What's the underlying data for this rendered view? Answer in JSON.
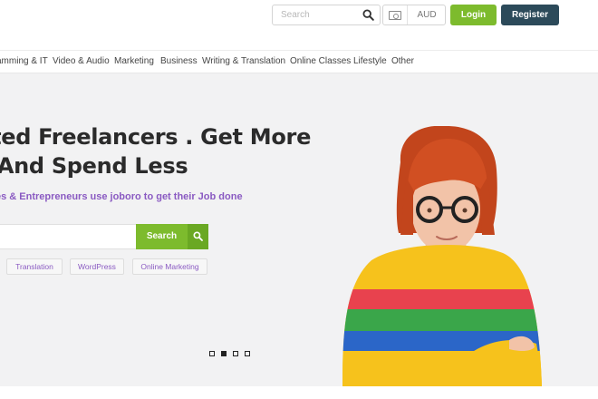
{
  "header": {
    "search_placeholder": "Search",
    "currency_code": "AUD",
    "login_label": "Login",
    "register_label": "Register"
  },
  "categories": [
    "amming & IT",
    "Video & Audio",
    "Marketing",
    "Business",
    "Writing & Translation",
    "Online Classes",
    "Lifestyle",
    "Other"
  ],
  "hero": {
    "headline_line1": "Rated Freelancers . Get More",
    "headline_line2": "ne And Spend Less",
    "subheadline": "usinesses & Entrepreneurs use joboro to get their Job done",
    "search_button_label": "Search",
    "tags": [
      "Translation",
      "WordPress",
      "Online Marketing"
    ],
    "slider_active_index": 1,
    "slider_count": 4
  },
  "colors": {
    "accent_green": "#7dbb2d",
    "register_navy": "#2c4a5a",
    "tag_purple": "#8a5ac2",
    "hero_bg": "#f2f2f3"
  }
}
